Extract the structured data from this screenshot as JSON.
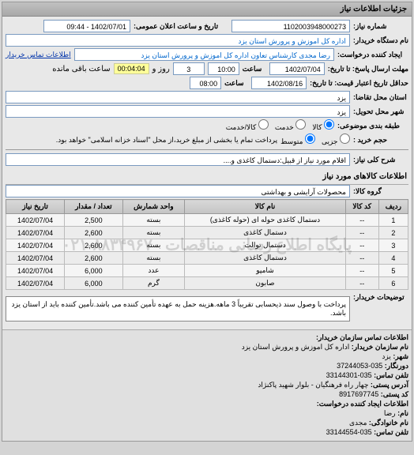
{
  "header": {
    "title": "جزئیات اطلاعات نیاز"
  },
  "form": {
    "req_no_label": "شماره نیاز:",
    "req_no": "1102003948000273",
    "announce_label": "تاریخ و ساعت اعلان عمومی:",
    "announce": "1402/07/01 - 09:44",
    "buyer_label": "نام دستگاه خریدار:",
    "buyer": "اداره کل اموزش و پرورش استان یزد",
    "creator_label": "ایجاد کننده درخواست:",
    "creator": "رضا مجدی کارشناس تعاون اداره کل اموزش و پرورش استان یزد",
    "contact_link": "اطلاعات تماس خریدار",
    "deadline_label": "مهلت ارسال پاسخ: تا تاریخ:",
    "deadline_date": "1402/07/04",
    "time_label": "ساعت",
    "deadline_time": "10:00",
    "days": "3",
    "day_word": "روز و",
    "countdown": "00:04:04",
    "remaining": "ساعت باقی مانده",
    "validity_label": "حداقل تاریخ اعتبار قیمت: تا تاریخ:",
    "validity_date": "1402/08/16",
    "validity_time": "08:00",
    "province_label": "استان محل تقاضا:",
    "province": "یزد",
    "city_label": "شهر محل تحویل:",
    "city": "یزد",
    "class_label": "طبقه بندی موضوعی:",
    "class_opts": {
      "a": "کالا",
      "b": "خدمت",
      "c": "کالا/خدمت"
    },
    "volume_label": "حجم خرید :",
    "volume_opts": {
      "a": "جزیی",
      "b": "متوسط"
    },
    "volume_note": "پرداخت تمام یا بخشی از مبلغ خرید،از محل \"اسناد خزانه اسلامی\" خواهد بود.",
    "desc_label": "شرح کلی نیاز:",
    "desc": "اقلام مورد نیاز از قبیل:دستمال کاغذی و....",
    "items_title": "اطلاعات کالاهای مورد نیاز",
    "group_label": "گروه کالا:",
    "group": "محصولات آرایشی و بهداشتی",
    "watermark": "پایگاه اطلاع رسانی مناقصات ۸۸۳۴۹۶۷۰-۰۲۱"
  },
  "table": {
    "headers": [
      "ردیف",
      "کد کالا",
      "نام کالا",
      "واحد شمارش",
      "تعداد / مقدار",
      "تاریخ نیاز"
    ],
    "rows": [
      [
        "1",
        "--",
        "دستمال کاغذی حوله ای (حوله کاغذی)",
        "بسته",
        "2,500",
        "1402/07/04"
      ],
      [
        "2",
        "--",
        "دستمال کاغذی",
        "بسته",
        "2,600",
        "1402/07/04"
      ],
      [
        "3",
        "--",
        "دستمال توالت",
        "بسته",
        "2,600",
        "1402/07/04"
      ],
      [
        "4",
        "--",
        "دستمال کاغذی",
        "بسته",
        "2,600",
        "1402/07/04"
      ],
      [
        "5",
        "--",
        "شامپو",
        "عدد",
        "6,000",
        "1402/07/04"
      ],
      [
        "6",
        "--",
        "صابون",
        "گرم",
        "6,000",
        "1402/07/04"
      ]
    ]
  },
  "notes": {
    "label": "توضیحات خریدار:",
    "text": "پرداخت با وصول سند ذیحسابی تقریباً 3 ماهه.هزینه حمل به عهده تأمین کننده می باشد.تأمین کننده باید از استان یزد باشد."
  },
  "contact": {
    "title": "اطلاعات تماس سازمان خریدار:",
    "org_label": "نام سازمان خریدار:",
    "org": "اداره کل اموزش و پرورش استان یزد",
    "city_label": "شهر:",
    "city": "یزد",
    "phone_label": "دورنگار:",
    "phone": "035-37244053",
    "fax_label": "تلفن تماس:",
    "fax": "035-33144301",
    "addr_label": "آدرس پستی:",
    "addr": "چهار راه فرهنگیان - بلوار شهید پاکنژاد",
    "postal_label": "کد پستی:",
    "postal": "8917697745",
    "creator_title": "اطلاعات ایجاد کننده درخواست:",
    "name_label": "نام:",
    "name": "رضا",
    "family_label": "نام خانوادگی:",
    "family": "مجدی",
    "tel_label": "تلفن تماس:",
    "tel": "035-33144554"
  }
}
